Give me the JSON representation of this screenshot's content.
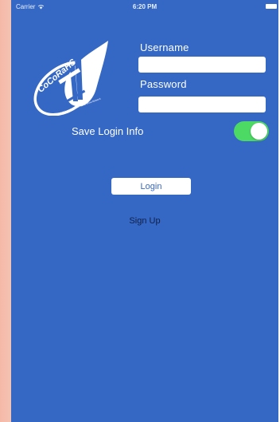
{
  "status_bar": {
    "carrier": "Carrier",
    "time": "6:20 PM"
  },
  "logo": {
    "name": "CoCoRaHS",
    "tagline": "Community Collaborative Rain, Hail & Snow Network"
  },
  "form": {
    "username_label": "Username",
    "username_value": "",
    "password_label": "Password",
    "password_value": "",
    "save_login_label": "Save Login Info",
    "save_login_enabled": true
  },
  "actions": {
    "login_label": "Login",
    "signup_label": "Sign Up"
  },
  "colors": {
    "background": "#3568c4",
    "toggle_on": "#4cd964",
    "signup_text": "#10204a",
    "side_tint": "#f6b9a8"
  }
}
